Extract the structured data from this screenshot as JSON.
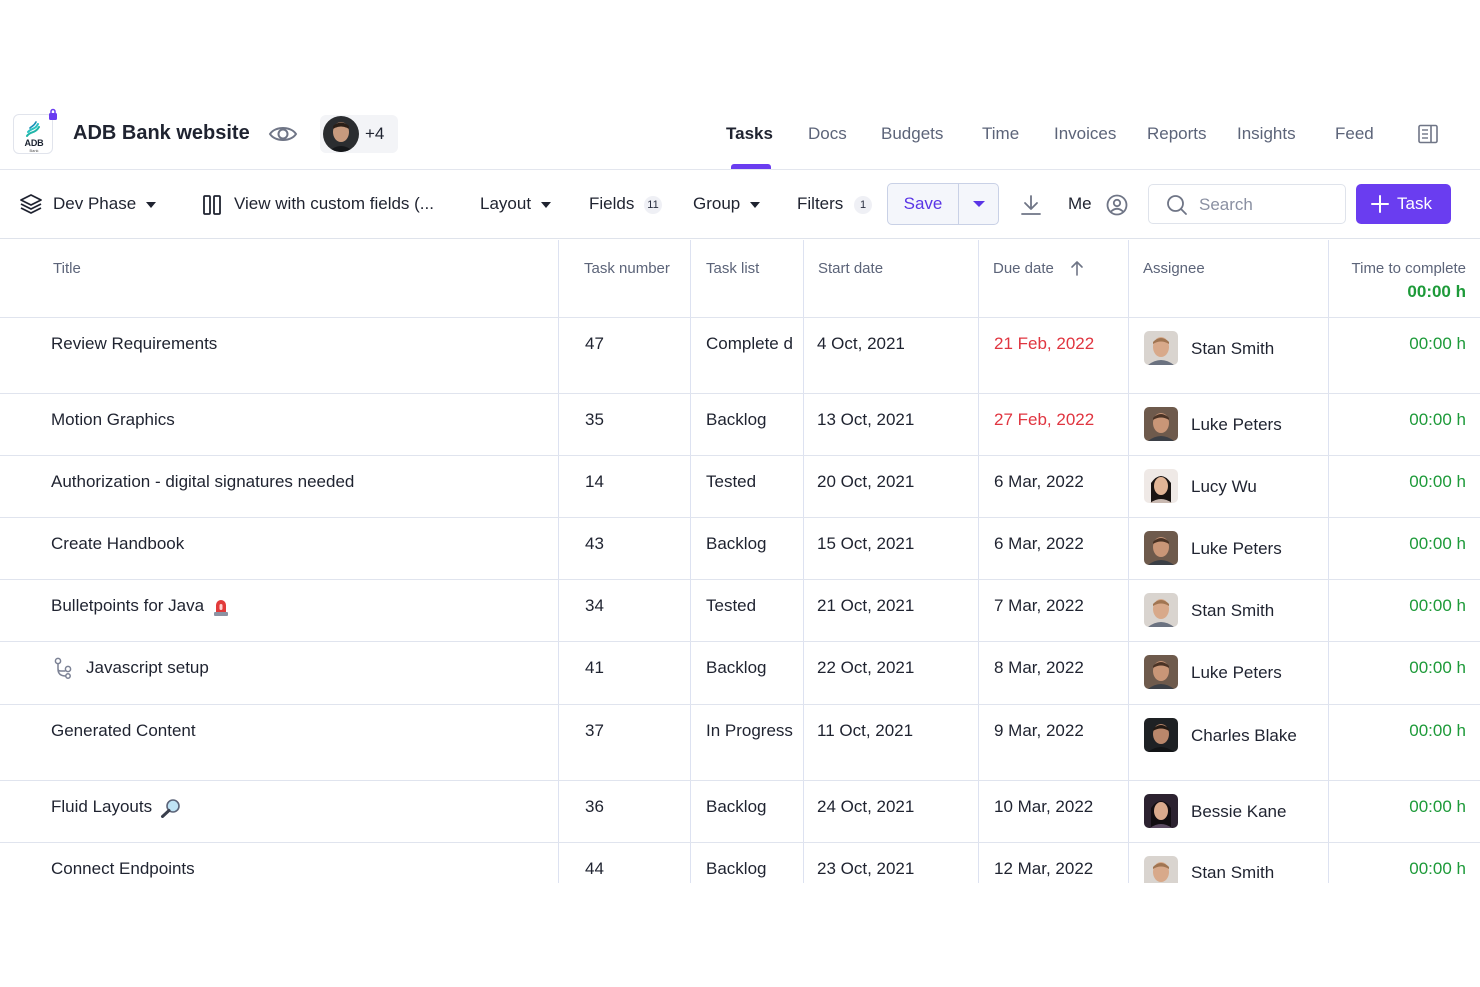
{
  "project": {
    "title": "ADB Bank website",
    "logo_text": "ADB",
    "logo_subtext": "Bank",
    "members_more": "+4"
  },
  "nav": {
    "tabs": [
      {
        "label": "Tasks",
        "active": true
      },
      {
        "label": "Docs"
      },
      {
        "label": "Budgets"
      },
      {
        "label": "Time"
      },
      {
        "label": "Invoices"
      },
      {
        "label": "Reports"
      },
      {
        "label": "Insights"
      },
      {
        "label": "Feed"
      }
    ]
  },
  "toolbar": {
    "phase": "Dev Phase",
    "view": "View with custom fields (...",
    "layout": "Layout",
    "fields": "Fields",
    "fields_count": "11",
    "group": "Group",
    "filters": "Filters",
    "filters_count": "1",
    "save": "Save",
    "me": "Me",
    "search_placeholder": "Search",
    "task_button": "Task"
  },
  "table": {
    "columns": [
      "Title",
      "Task number",
      "Task list",
      "Start date",
      "Due date",
      "Assignee",
      "Time to complete"
    ],
    "total_time": "00:00 h",
    "rows": [
      {
        "title": "Review Requirements",
        "number": "47",
        "list": "Complete d",
        "start": "4 Oct, 2021",
        "due": "21 Feb, 2022",
        "late": true,
        "assignee": "Stan Smith",
        "time": "00:00 h"
      },
      {
        "title": "Motion Graphics",
        "number": "35",
        "list": "Backlog",
        "start": "13 Oct, 2021",
        "due": "27 Feb, 2022",
        "late": true,
        "assignee": "Luke Peters",
        "time": "00:00 h"
      },
      {
        "title": "Authorization - digital signatures needed",
        "number": "14",
        "list": "Tested",
        "start": "20 Oct, 2021",
        "due": "6 Mar, 2022",
        "assignee": "Lucy Wu",
        "time": "00:00 h"
      },
      {
        "title": "Create Handbook",
        "number": "43",
        "list": "Backlog",
        "start": "15 Oct, 2021",
        "due": "6 Mar, 2022",
        "assignee": "Luke Peters",
        "time": "00:00 h"
      },
      {
        "title": "Bulletpoints for Java",
        "number": "34",
        "list": "Tested",
        "start": "21 Oct, 2021",
        "due": "7 Mar, 2022",
        "assignee": "Stan Smith",
        "time": "00:00 h"
      },
      {
        "title": "Javascript setup",
        "number": "41",
        "list": "Backlog",
        "start": "22 Oct, 2021",
        "due": "8 Mar, 2022",
        "assignee": "Luke Peters",
        "time": "00:00 h"
      },
      {
        "title": "Generated Content",
        "number": "37",
        "list": "In Progress",
        "start": "11 Oct, 2021",
        "due": "9 Mar, 2022",
        "assignee": "Charles Blake",
        "time": "00:00 h"
      },
      {
        "title": "Fluid Layouts",
        "number": "36",
        "list": "Backlog",
        "start": "24 Oct, 2021",
        "due": "10 Mar, 2022",
        "assignee": "Bessie Kane",
        "time": "00:00 h"
      },
      {
        "title": "Connect Endpoints",
        "number": "44",
        "list": "Backlog",
        "start": "23 Oct, 2021",
        "due": "12 Mar, 2022",
        "assignee": "Stan Smith",
        "time": "00:00 h"
      }
    ]
  },
  "colors": {
    "accent": "#6a3df0",
    "overdue": "#e03540",
    "time_green": "#1d9a39"
  }
}
